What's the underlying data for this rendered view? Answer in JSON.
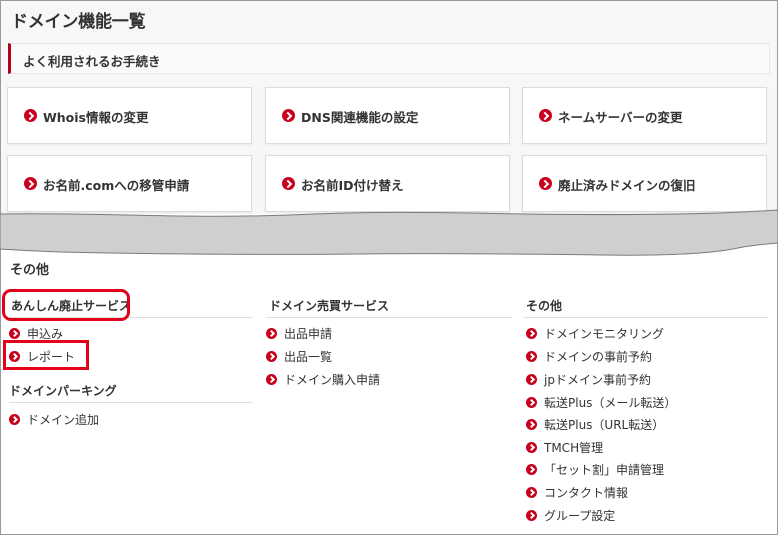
{
  "page": {
    "title": "ドメイン機能一覧"
  },
  "frequent": {
    "heading": "よく利用されるお手続き",
    "items": [
      {
        "label": "Whois情報の変更"
      },
      {
        "label": "DNS関連機能の設定"
      },
      {
        "label": "ネームサーバーの変更"
      },
      {
        "label": "お名前.comへの移管申請"
      },
      {
        "label": "お名前ID付け替え"
      },
      {
        "label": "廃止済みドメインの復旧"
      }
    ]
  },
  "other": {
    "title": "その他",
    "columns": [
      {
        "heading": "あんしん廃止サービス",
        "links": [
          {
            "label": "申込み"
          },
          {
            "label": "レポート"
          }
        ],
        "sub_heading": "ドメインパーキング",
        "sub_links": [
          {
            "label": "ドメイン追加"
          }
        ]
      },
      {
        "heading": "ドメイン売買サービス",
        "links": [
          {
            "label": "出品申請"
          },
          {
            "label": "出品一覧"
          },
          {
            "label": "ドメイン購入申請"
          }
        ]
      },
      {
        "heading": "その他",
        "links": [
          {
            "label": "ドメインモニタリング"
          },
          {
            "label": "ドメインの事前予約"
          },
          {
            "label": "jpドメイン事前予約"
          },
          {
            "label": "転送Plus（メール転送）"
          },
          {
            "label": "転送Plus（URL転送）"
          },
          {
            "label": "TMCH管理"
          },
          {
            "label": "「セット割」申請管理"
          },
          {
            "label": "コンタクト情報"
          },
          {
            "label": "グループ設定"
          }
        ]
      }
    ]
  },
  "colors": {
    "accent": "#c8001e",
    "highlight": "#e3001b",
    "tear": "#cfcfcf"
  },
  "icons": {
    "link_arrow": "chevron-right-circle-icon"
  }
}
